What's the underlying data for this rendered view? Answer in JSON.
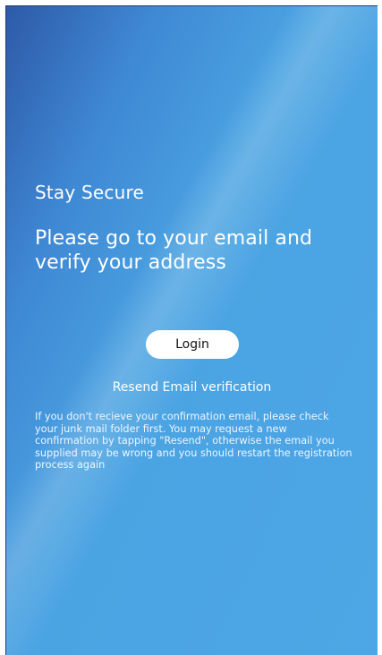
{
  "screen": {
    "subtitle": "Stay Secure",
    "headline": "Please go to your email and verify your address",
    "login_button": "Login",
    "resend_link": "Resend Email verification",
    "help_text": "If you don't recieve your confirmation email, please check your junk mail folder first.  You may request a new confirmation by tapping \"Resend\", otherwise the email you supplied may be wrong and you should restart the registration process again"
  },
  "colors": {
    "gradient_start": "#2d5aa8",
    "gradient_mid": "#4aa3e2",
    "gradient_end": "#4da6e5",
    "button_bg": "#ffffff",
    "text": "#ffffff"
  }
}
